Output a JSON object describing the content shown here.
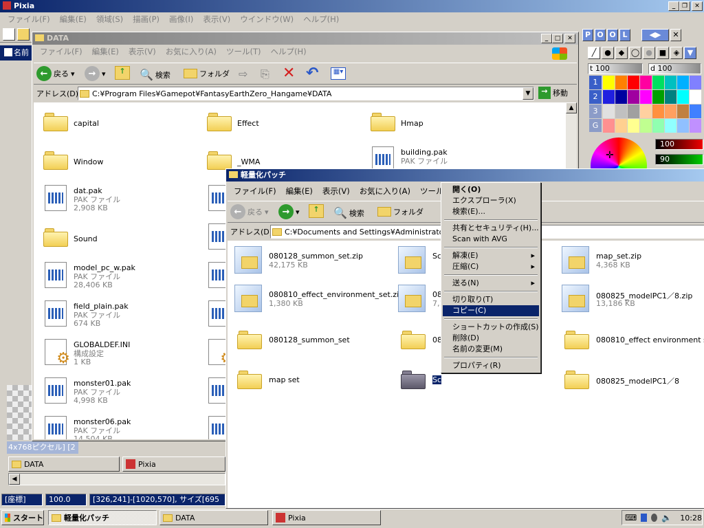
{
  "pixia": {
    "title": "Pixia",
    "menu": [
      "ファイル(F)",
      "編集(E)",
      "領域(S)",
      "描画(P)",
      "画像(I)",
      "表示(V)",
      "ウインドウ(W)",
      "ヘルプ(H)"
    ],
    "doc_title_fragment": "名前",
    "status_fragment": "4x768ピクセル] [2",
    "status": {
      "label": "[座標]",
      "zoom": "100.0",
      "coords": "[326,241]-[1020,570], サイズ[695"
    },
    "doc_tabs": [
      "DATA",
      "Pixia"
    ],
    "panel": {
      "tabs": [
        "P",
        "O",
        "O",
        "L"
      ],
      "t_label": "t",
      "t_value": "100",
      "d_label": "d",
      "d_value": "100",
      "rows": [
        "1",
        "2",
        "3",
        "G"
      ],
      "slider1": "100",
      "slider2": "90"
    }
  },
  "data_window": {
    "title": "DATA",
    "menu": [
      "ファイル(F)",
      "編集(E)",
      "表示(V)",
      "お気に入り(A)",
      "ツール(T)",
      "ヘルプ(H)"
    ],
    "toolbar": {
      "back": "戻る",
      "search": "検索",
      "folders": "フォルダ"
    },
    "address_label": "アドレス(D)",
    "address": "C:¥Program Files¥Gamepot¥FantasyEarthZero_Hangame¥DATA",
    "go": "移動",
    "col1": [
      {
        "name": "capital",
        "type": "folder"
      },
      {
        "name": "Window",
        "type": "folder"
      },
      {
        "name": "dat.pak",
        "type": "pak",
        "kind": "PAK ファイル",
        "size": "2,908 KB"
      },
      {
        "name": "Sound",
        "type": "folder"
      },
      {
        "name": "model_pc_w.pak",
        "type": "pak",
        "kind": "PAK ファイル",
        "size": "28,406 KB"
      },
      {
        "name": "field_plain.pak",
        "type": "pak",
        "kind": "PAK ファイル",
        "size": "674 KB"
      },
      {
        "name": "GLOBALDEF.INI",
        "type": "ini",
        "kind": "構成設定",
        "size": "1 KB"
      },
      {
        "name": "monster01.pak",
        "type": "pak",
        "kind": "PAK ファイル",
        "size": "4,998 KB"
      },
      {
        "name": "monster06.pak",
        "type": "pak",
        "kind": "PAK ファイル",
        "size": "14,504 KB"
      }
    ],
    "col2": [
      {
        "name": "Effect",
        "type": "folder"
      },
      {
        "name": "_WMA",
        "type": "folder"
      }
    ],
    "col3": [
      {
        "name": "Hmap",
        "type": "folder"
      },
      {
        "name": "building.pak",
        "type": "pak",
        "kind": "PAK ファイル"
      }
    ]
  },
  "light_window": {
    "title": "軽量化パッチ",
    "menu": [
      "ファイル(F)",
      "編集(E)",
      "表示(V)",
      "お気に入り(A)",
      "ツール(T"
    ],
    "toolbar": {
      "back": "戻る",
      "search": "検索",
      "folders": "フォルダ"
    },
    "address_label": "アドレス(D)",
    "address": "C:¥Documents and Settings¥Administrator¥デ",
    "items": [
      {
        "name": "080128_summon_set.zip",
        "size": "42,175 KB",
        "type": "zip"
      },
      {
        "name": "Sc",
        "size": "",
        "type": "zip"
      },
      {
        "name": "map_set.zip",
        "size": "4,368 KB",
        "type": "zip"
      },
      {
        "name": "080810_effect_environment_set.zip",
        "size": "1,380 KB",
        "type": "zip"
      },
      {
        "name": "08",
        "size": "7,1",
        "type": "zip"
      },
      {
        "name": "080825_modelPC1／8.zip",
        "size": "13,186 KB",
        "type": "zip"
      },
      {
        "name": "080128_summon_set",
        "type": "folder"
      },
      {
        "name": "08",
        "type": "folder"
      },
      {
        "name": "080810_effect environment set",
        "type": "folder"
      },
      {
        "name": "map set",
        "type": "folder"
      },
      {
        "name": "Sc",
        "type": "folder-selected"
      },
      {
        "name": "080825_modelPC1／8",
        "type": "folder"
      }
    ]
  },
  "context_menu": [
    {
      "label": "開く(O)",
      "bold": true
    },
    {
      "label": "エクスプローラ(X)"
    },
    {
      "label": "検索(E)..."
    },
    {
      "sep": true
    },
    {
      "label": "共有とセキュリティ(H)..."
    },
    {
      "label": "Scan with AVG"
    },
    {
      "sep": true
    },
    {
      "label": "解凍(E)",
      "sub": true
    },
    {
      "label": "圧縮(C)",
      "sub": true
    },
    {
      "sep": true
    },
    {
      "label": "送る(N)",
      "sub": true
    },
    {
      "sep": true
    },
    {
      "label": "切り取り(T)"
    },
    {
      "label": "コピー(C)",
      "selected": true
    },
    {
      "sep": true
    },
    {
      "label": "ショートカットの作成(S)"
    },
    {
      "label": "削除(D)"
    },
    {
      "label": "名前の変更(M)"
    },
    {
      "sep": true
    },
    {
      "label": "プロパティ(R)"
    }
  ],
  "taskbar": {
    "start": "スタート",
    "tasks": [
      "軽量化パッチ",
      "DATA",
      "Pixia"
    ],
    "clock": "10:28"
  },
  "colors": {
    "titlebar": "#0a246a",
    "face": "#d4d0c8",
    "highlight": "#0a246a"
  }
}
